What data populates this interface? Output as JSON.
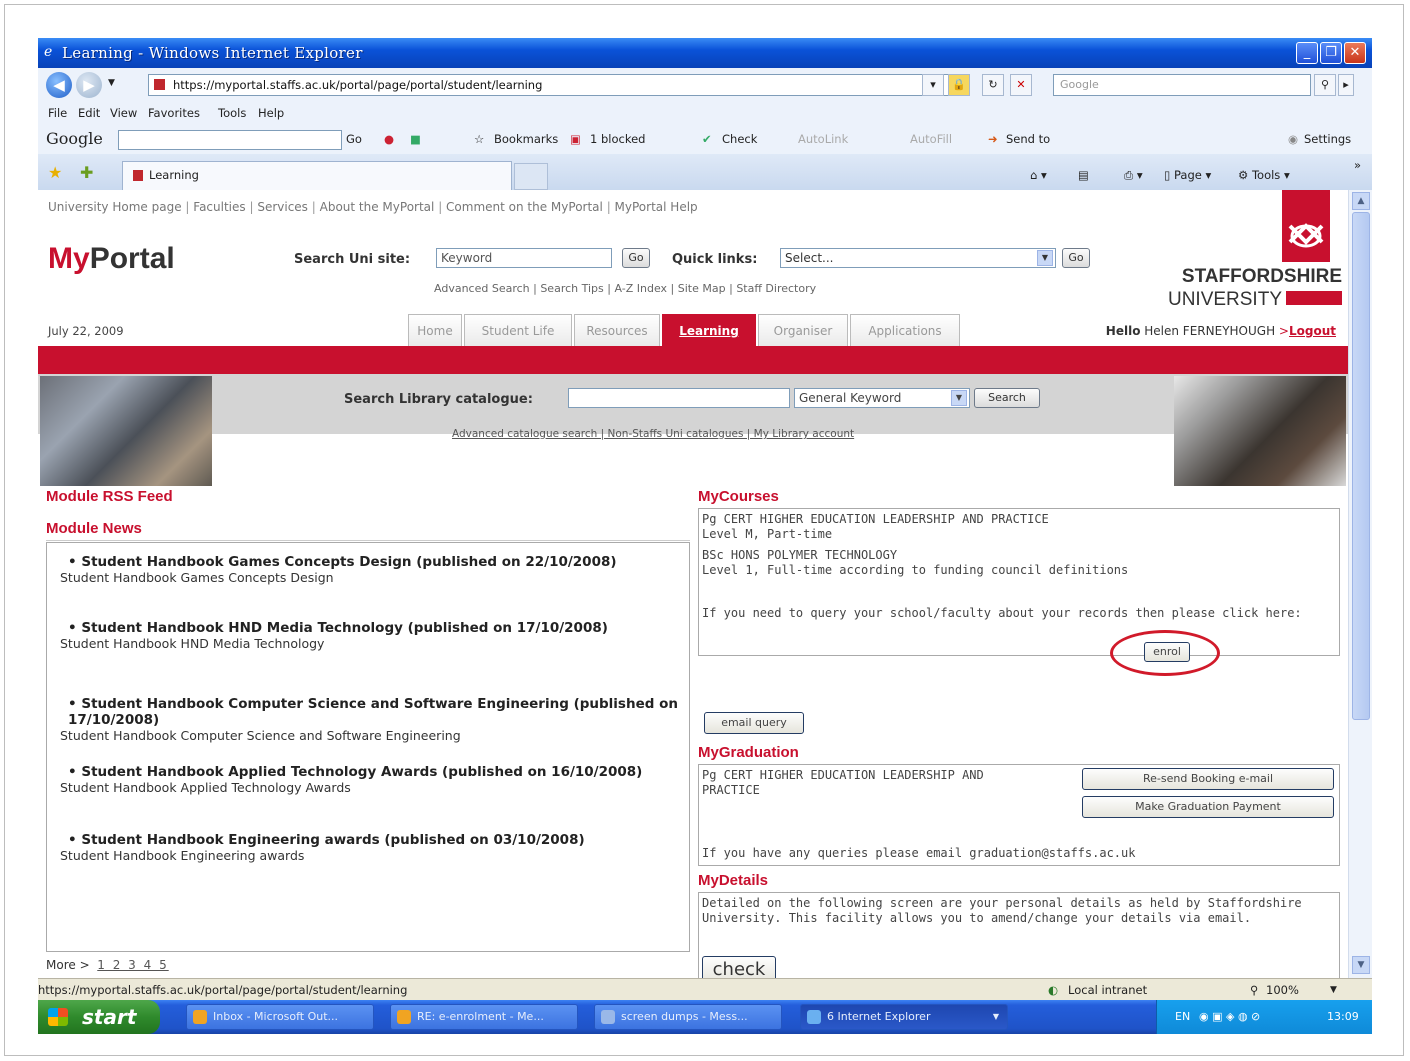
{
  "browser": {
    "title": "Learning - Windows Internet Explorer",
    "url": "https://myportal.staffs.ac.uk/portal/page/portal/student/learning",
    "search_placeholder": "Google",
    "menu": [
      "File",
      "Edit",
      "View",
      "Favorites",
      "Tools",
      "Help"
    ],
    "google_toolbar": {
      "logo": "Google",
      "go": "Go",
      "bookmarks": "Bookmarks",
      "blocked": "1 blocked",
      "check": "Check",
      "autolink": "AutoLink",
      "autofill": "AutoFill",
      "send_to": "Send to",
      "settings": "Settings"
    },
    "tab_label": "Learning",
    "tab_tools": {
      "page": "Page",
      "tools": "Tools"
    },
    "status_url": "https://myportal.staffs.ac.uk/portal/page/portal/student/learning",
    "zone": "Local intranet",
    "zoom": "100%"
  },
  "portal": {
    "top_links": [
      "University Home page",
      "Faculties",
      "Services",
      "About the MyPortal",
      "Comment on the MyPortal",
      "MyPortal Help"
    ],
    "logo_my": "My",
    "logo_portal": "Portal",
    "search_label": "Search Uni site:",
    "search_placeholder": "Keyword",
    "go": "Go",
    "quick_links_label": "Quick links:",
    "quick_links_value": "Select...",
    "sub_links": [
      "Advanced Search",
      "Search Tips",
      "A-Z Index",
      "Site Map",
      "Staff Directory"
    ],
    "university_line1": "STAFFORDSHIRE",
    "university_line2": "UNIVERSITY",
    "date": "July 22, 2009",
    "tabs": [
      "Home",
      "Student Life",
      "Resources",
      "Learning",
      "Organiser",
      "Applications"
    ],
    "hello_prefix": "Hello",
    "user_name": "Helen FERNEYHOUGH",
    "logout_arrow": ">",
    "logout": "Logout",
    "library": {
      "label": "Search Library catalogue:",
      "select_value": "General Keyword",
      "search": "Search",
      "links": "Advanced catalogue search | Non-Staffs Uni catalogues | My Library account"
    }
  },
  "left": {
    "rss_heading": "Module RSS Feed",
    "news_heading": "Module News",
    "news": [
      {
        "title": "Student Handbook Games Concepts Design (published on 22/10/2008)",
        "sub": "Student Handbook Games Concepts Design"
      },
      {
        "title": "Student Handbook HND Media Technology (published on 17/10/2008)",
        "sub": "Student Handbook HND Media Technology"
      },
      {
        "title": "Student Handbook Computer Science and Software Engineering (published on 17/10/2008)",
        "sub": "Student Handbook Computer Science and Software Engineering"
      },
      {
        "title": "Student Handbook Applied Technology Awards (published on 16/10/2008)",
        "sub": "Student Handbook Applied Technology Awards"
      },
      {
        "title": "Student Handbook Engineering awards (published on 03/10/2008)",
        "sub": "Student Handbook Engineering awards"
      }
    ],
    "more": "More >",
    "pages": "1 2 3 4 5"
  },
  "right": {
    "courses_heading": "MyCourses",
    "course1_line1": "Pg CERT HIGHER EDUCATION LEADERSHIP AND PRACTICE",
    "course1_line2": "Level M, Part-time",
    "course2_line1": "BSc HONS POLYMER TECHNOLOGY",
    "course2_line2": "Level 1, Full-time according to funding council definitions",
    "enrol": "enrol",
    "query_text": "If you need to query your school/faculty about your records then please click here:",
    "email_query": "email query",
    "graduation_heading": "MyGraduation",
    "grad_line1": "Pg CERT HIGHER EDUCATION LEADERSHIP AND",
    "grad_line2": "PRACTICE",
    "resend": "Re-send Booking e-mail",
    "payment": "Make Graduation Payment",
    "grad_query": "If you have any queries please email graduation@staffs.ac.uk",
    "details_heading": "MyDetails",
    "details_line1": "Detailed on the following screen are your personal details as held by Staffordshire",
    "details_line2": "University. This facility allows you to amend/change your details via email.",
    "check": "check"
  },
  "taskbar": {
    "start": "start",
    "tasks": [
      "Inbox - Microsoft Out...",
      "RE: e-enrolment - Me...",
      "screen dumps - Mess...",
      "6 Internet Explorer"
    ],
    "lang": "EN",
    "time": "13:09"
  },
  "colors": {
    "brand_red": "#c8102e",
    "xp_blue": "#0a52d8",
    "annotation_red": "#d11a2a"
  }
}
